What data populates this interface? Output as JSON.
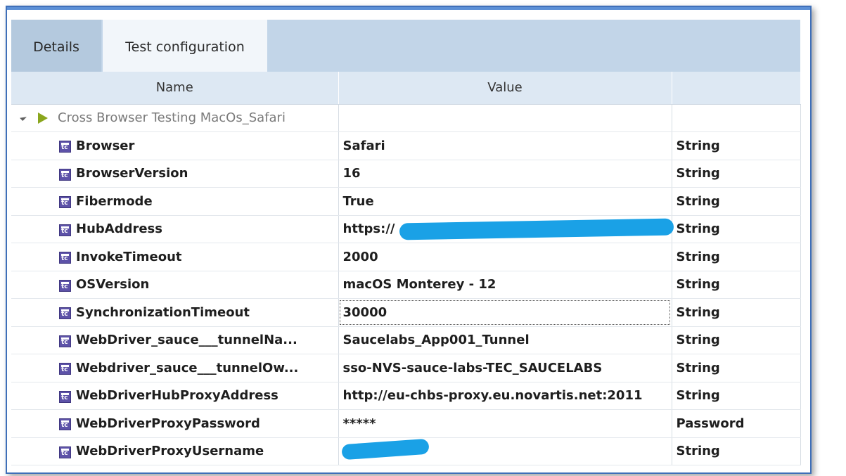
{
  "tabs": [
    {
      "label": "Details"
    },
    {
      "label": "Test configuration"
    }
  ],
  "columns": {
    "name": "Name",
    "value": "Value",
    "type": ""
  },
  "group": {
    "label": "Cross Browser Testing MacOs_Safari"
  },
  "rows": [
    {
      "name": "Browser",
      "value": "Safari",
      "type": "String"
    },
    {
      "name": "BrowserVersion",
      "value": "16",
      "type": "String"
    },
    {
      "name": "Fibermode",
      "value": "True",
      "type": "String"
    },
    {
      "name": "HubAddress",
      "value": "https://",
      "type": "String"
    },
    {
      "name": "InvokeTimeout",
      "value": "2000",
      "type": "String"
    },
    {
      "name": "OSVersion",
      "value": "macOS Monterey - 12",
      "type": "String"
    },
    {
      "name": "SynchronizationTimeout",
      "value": "30000",
      "type": "String"
    },
    {
      "name": "WebDriver_sauce___tunnelNa...",
      "value": "Saucelabs_App001_Tunnel",
      "type": "String"
    },
    {
      "name": "Webdriver_sauce___tunnelOw...",
      "value": "sso-NVS-sauce-labs-TEC_SAUCELABS",
      "type": "String"
    },
    {
      "name": "WebDriverHubProxyAddress",
      "value": "http://eu-chbs-proxy.eu.novartis.net:2011",
      "type": "String"
    },
    {
      "name": "WebDriverProxyPassword",
      "value": "*****",
      "type": "Password"
    },
    {
      "name": "WebDriverProxyUsername",
      "value": "",
      "type": "String"
    }
  ],
  "colors": {
    "frame": "#3f6fb8",
    "tabbar": "#c2d5e8",
    "header": "#dde8f3",
    "redaction": "#1aa1e6",
    "icon": "#5d52a8"
  }
}
